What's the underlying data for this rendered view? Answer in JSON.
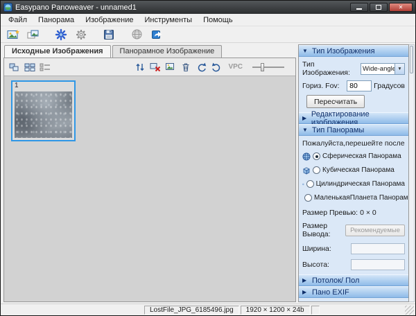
{
  "window": {
    "title": "Easypano Panoweaver - unnamed1"
  },
  "menu": {
    "items": [
      "Файл",
      "Панорама",
      "Изображение",
      "Инструменты",
      "Помощь"
    ]
  },
  "toolbar": {
    "icons": [
      "new-panorama",
      "open-images",
      "stitch",
      "settings",
      "save",
      "publish",
      "share"
    ]
  },
  "tabs": {
    "source": "Исходные Изображения",
    "panorama": "Панорамное Изображение"
  },
  "source_toolbar": {
    "view_icons": [
      "view-large-thumbnails",
      "view-small-thumbnails",
      "view-list"
    ],
    "action_icons": [
      "sort-images",
      "delete-image",
      "image-properties",
      "trash",
      "rotate-left",
      "rotate-right"
    ],
    "vpc_label": "VPC"
  },
  "thumbnail": {
    "index": "1"
  },
  "panels": {
    "image_type": {
      "title": "Тип Изображения",
      "expanded": true,
      "type_label": "Тип Изображения:",
      "type_value": "Wide-angle/ N",
      "fov_label": "Гориз. Fov:",
      "fov_value": "80",
      "fov_unit": "Градусов",
      "recalc_button": "Пересчитать"
    },
    "image_edit": {
      "title": "Редактирование изображения",
      "expanded": false
    },
    "panorama_type": {
      "title": "Тип Панорамы",
      "expanded": true,
      "hint": "Пожалуйста,перешейте после",
      "options": [
        {
          "label": "Сферическая Панорама",
          "icon": "sphere-icon",
          "selected": true
        },
        {
          "label": "Кубическая Панорама",
          "icon": "cube-icon",
          "selected": false
        },
        {
          "label": "Цилиндрическая Панорама",
          "icon": "cylinder-icon",
          "selected": false
        },
        {
          "label": "МаленькаяПланета Панорама",
          "icon": "little-planet-icon",
          "selected": false
        }
      ],
      "preview_size_label": "Размер Превью:",
      "preview_size_value": "0 × 0",
      "output_size_label": "Размер Вывода:",
      "recommended_button": "Рекомендуемые",
      "width_label": "Ширина:",
      "width_value": "",
      "height_label": "Высота:",
      "height_value": ""
    },
    "ceiling_floor": {
      "title": "Потолок/ Пол",
      "expanded": false
    },
    "pano_exif": {
      "title": "Пано EXIF",
      "expanded": false
    }
  },
  "statusbar": {
    "filename": "LostFile_JPG_6185496.jpg",
    "dimensions": "1920 × 1200 × 24b"
  }
}
